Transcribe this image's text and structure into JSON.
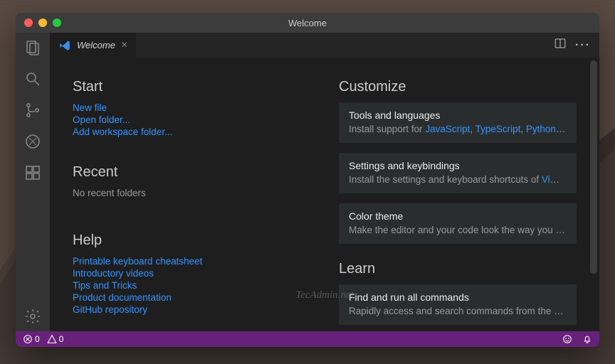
{
  "title": "Welcome",
  "tab": {
    "label": "Welcome"
  },
  "start": {
    "heading": "Start",
    "links": [
      "New file",
      "Open folder...",
      "Add workspace folder..."
    ]
  },
  "recent": {
    "heading": "Recent",
    "empty": "No recent folders"
  },
  "help": {
    "heading": "Help",
    "links": [
      "Printable keyboard cheatsheet",
      "Introductory videos",
      "Tips and Tricks",
      "Product documentation",
      "GitHub repository"
    ]
  },
  "customize": {
    "heading": "Customize",
    "cards": [
      {
        "title": "Tools and languages",
        "desc_prefix": "Install support for ",
        "langs": [
          "JavaScript",
          "TypeScript",
          "Python",
          "P…"
        ]
      },
      {
        "title": "Settings and keybindings",
        "desc_prefix": "Install the settings and keyboard shortcuts of ",
        "editors": [
          "Vim"
        ],
        "desc_suffix": ", …"
      },
      {
        "title": "Color theme",
        "desc": "Make the editor and your code look the way you love"
      }
    ]
  },
  "learn": {
    "heading": "Learn",
    "cards": [
      {
        "title": "Find and run all commands",
        "desc": "Rapidly access and search commands from the Co…"
      }
    ]
  },
  "status": {
    "errors": "0",
    "warnings": "0"
  },
  "watermark": "TecAdmin.net",
  "colors": {
    "accent": "#3794ff",
    "statusbar": "#68217a",
    "card": "#2a2d2e"
  }
}
